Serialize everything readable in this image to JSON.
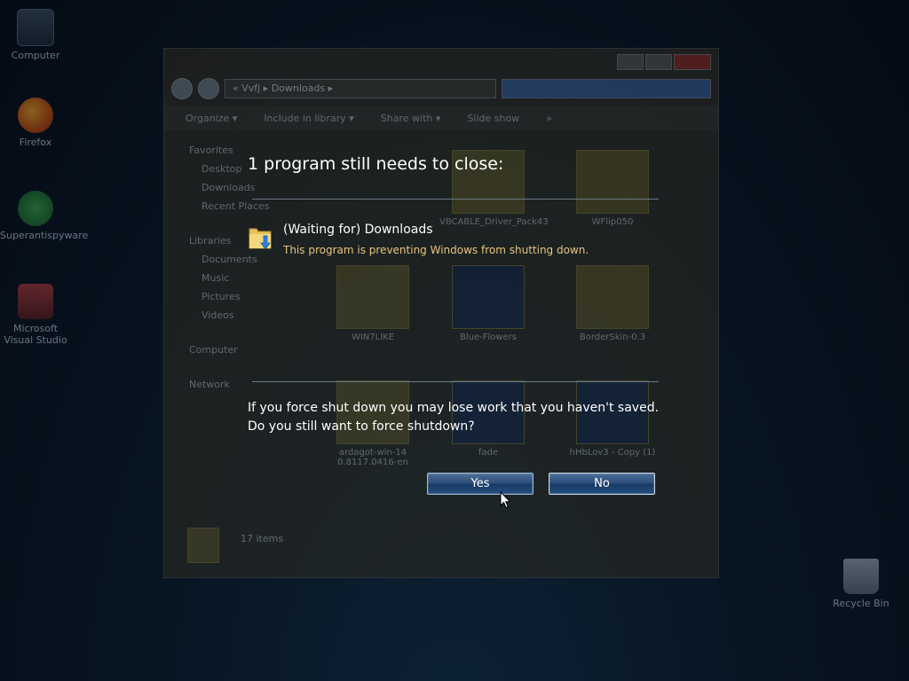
{
  "desktop": {
    "icons": [
      {
        "label": "Computer"
      },
      {
        "label": "Firefox"
      },
      {
        "label": "Superantispyware"
      },
      {
        "label": "Microsoft Visual Studio"
      },
      {
        "label": "Recycle Bin"
      }
    ]
  },
  "explorer": {
    "address": "« Vvfj ▸ Downloads ▸",
    "toolbar": [
      "Organize ▾",
      "Include in library ▾",
      "Share with ▾",
      "Slide show",
      "»"
    ],
    "sidebar": {
      "favorites": "Favorites",
      "favorites_items": [
        "Desktop",
        "Downloads",
        "Recent Places"
      ],
      "libraries": "Libraries",
      "libraries_items": [
        "Documents",
        "Music",
        "Pictures",
        "Videos"
      ],
      "computer": "Computer",
      "network": "Network"
    },
    "files": [
      "VBCABLE_Driver_Pack43",
      "WFlip050",
      "WIN7LIKE",
      "Blue-Flowers",
      "BorderSkin-0.3",
      "ardagot-win-14 0.8117.0416-en",
      "fade",
      "hHbLov3 - Copy (1)"
    ],
    "status": "17 items"
  },
  "dialog": {
    "title": "1 program still needs to close:",
    "program_name": "(Waiting for) Downloads",
    "program_desc": "This program is preventing Windows from shutting down.",
    "warning_line1": "If you force shut down you may lose work that you haven't saved.",
    "warning_line2": "Do you still want to force shutdown?",
    "yes_label": "Yes",
    "no_label": "No"
  },
  "colors": {
    "desc_text": "#e8c47a",
    "button_blue": "#2b4d78"
  }
}
